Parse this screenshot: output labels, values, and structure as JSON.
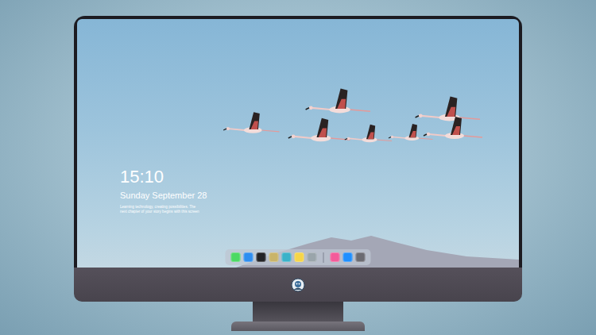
{
  "lock_screen": {
    "time": "15:10",
    "date": "Sunday September 28",
    "caption": [
      "Learning technology, creating possibilities. The",
      "next chapter of your story begins with this screen"
    ]
  },
  "dock": {
    "apps": [
      {
        "color": "#4cd964"
      },
      {
        "color": "#2e8ef0"
      },
      {
        "color": "#232326"
      },
      {
        "color": "#c9b46a"
      },
      {
        "color": "#3ab2c9"
      },
      {
        "color": "#f6d548"
      },
      {
        "color": "#9aa5ab"
      }
    ],
    "recent": [
      {
        "color": "#f35b9a"
      },
      {
        "color": "#1e8fff"
      },
      {
        "color": "#6b6b72"
      }
    ]
  }
}
